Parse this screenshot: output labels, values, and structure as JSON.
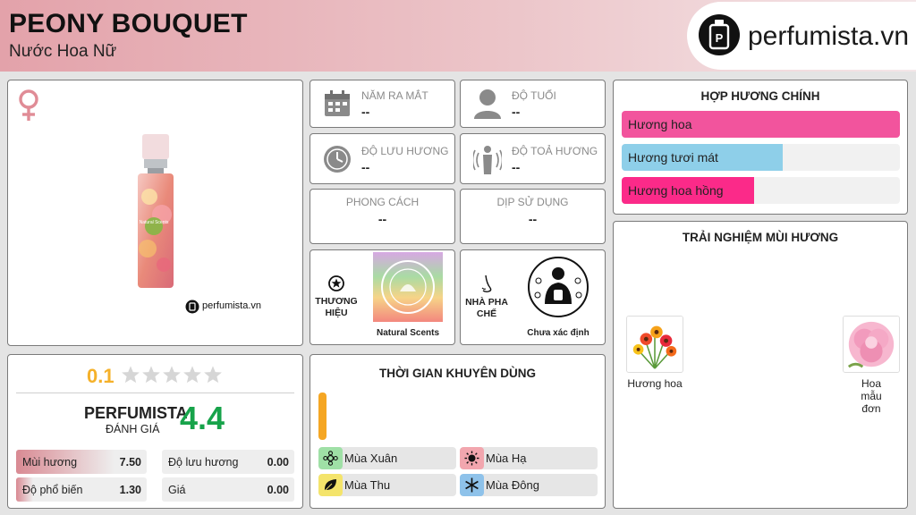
{
  "header": {
    "title": "PEONY BOUQUET",
    "subtitle": "Nước Hoa Nữ",
    "logo_text": "perfumista.vn"
  },
  "product": {
    "gender_icon": "female-icon",
    "watermark": "perfumista.vn",
    "bottle_label": "Natural Scents"
  },
  "info": {
    "release_label": "NĂM RA MẮT",
    "release_value": "--",
    "age_label": "ĐỘ TUỔI",
    "age_value": "--",
    "longevity_label": "ĐỘ LƯU HƯƠNG",
    "longevity_value": "--",
    "sillage_label": "ĐỘ TOẢ HƯƠNG",
    "sillage_value": "--",
    "style_label": "PHONG CÁCH",
    "style_value": "--",
    "occasion_label": "DỊP SỬ DỤNG",
    "occasion_value": "--",
    "brand_label_1": "THƯƠNG",
    "brand_label_2": "HIỆU",
    "brand_name": "Natural Scents",
    "perfumer_label_1": "NHÀ PHA",
    "perfumer_label_2": "CHẾ",
    "perfumer_name": "Chưa xác định"
  },
  "accords": {
    "title": "HỢP HƯƠNG CHÍNH",
    "items": [
      {
        "label": "Hương hoa",
        "value": 1.0,
        "color": "#f2549d"
      },
      {
        "label": "Hương tươi mát",
        "value": 0.58,
        "color": "#8ecfe9"
      },
      {
        "label": "Hương hoa hồng",
        "value": 0.476,
        "color": "#fb2a89"
      }
    ]
  },
  "notes": {
    "title": "TRẢI NGHIỆM MÙI HƯƠNG",
    "items": [
      {
        "label": "Hương hoa"
      },
      {
        "label": "Hoa mẫu đơn"
      }
    ]
  },
  "rating": {
    "user_score": "0.1",
    "stars": 0.02,
    "brand": "PERFUMISTA",
    "brand_sub": "ĐÁNH GIÁ",
    "score": "4.4",
    "criteria": [
      {
        "label": "Mùi hương",
        "value": "7.50",
        "fill": 0.75
      },
      {
        "label": "Độ lưu hương",
        "value": "0.00",
        "fill": 0
      },
      {
        "label": "Độ phổ biến",
        "value": "1.30",
        "fill": 0.13
      },
      {
        "label": "Giá",
        "value": "0.00",
        "fill": 0
      }
    ]
  },
  "seasons": {
    "title": "THỜI GIAN KHUYÊN DÙNG",
    "items": [
      {
        "label": "Mùa Xuân",
        "color": "#9fe0a6",
        "icon": "spring-icon"
      },
      {
        "label": "Mùa Hạ",
        "color": "#f2a6ae",
        "icon": "sun-icon"
      },
      {
        "label": "Mùa Thu",
        "color": "#f4e46b",
        "icon": "leaf-icon"
      },
      {
        "label": "Mùa Đông",
        "color": "#8ec2ea",
        "icon": "snowflake-icon"
      }
    ],
    "day_night_color": "#f5a623"
  }
}
